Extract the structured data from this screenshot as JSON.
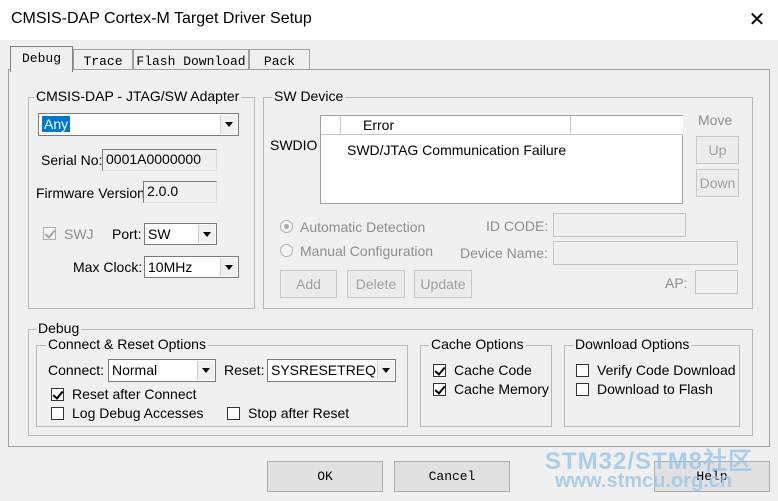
{
  "window": {
    "title": "CMSIS-DAP Cortex-M Target Driver Setup",
    "close_glyph": "✕"
  },
  "tabs": [
    {
      "label": "Debug",
      "active": true
    },
    {
      "label": "Trace",
      "active": false
    },
    {
      "label": "Flash Download",
      "active": false
    },
    {
      "label": "Pack",
      "active": false
    }
  ],
  "adapter": {
    "group_title": "CMSIS-DAP - JTAG/SW Adapter",
    "selected": "Any",
    "serial_label": "Serial No:",
    "serial_value": "0001A0000000",
    "firmware_label": "Firmware Version:",
    "firmware_value": "2.0.0",
    "swj_label": "SWJ",
    "swj_checked": true,
    "port_label": "Port:",
    "port_value": "SW",
    "maxclock_label": "Max Clock:",
    "maxclock_value": "10MHz"
  },
  "sw_device": {
    "group_title": "SW Device",
    "row_label": "SWDIO",
    "column_header": "Error",
    "error_text": "SWD/JTAG Communication Failure",
    "move_label": "Move",
    "up_label": "Up",
    "down_label": "Down",
    "auto_detect_label": "Automatic Detection",
    "manual_config_label": "Manual Configuration",
    "detection_mode": "Automatic Detection",
    "id_code_label": "ID CODE:",
    "device_name_label": "Device Name:",
    "ap_label": "AP:",
    "add_label": "Add",
    "delete_label": "Delete",
    "update_label": "Update"
  },
  "debug": {
    "group_title": "Debug",
    "connect_reset": {
      "title": "Connect & Reset Options",
      "connect_label": "Connect:",
      "connect_value": "Normal",
      "reset_label": "Reset:",
      "reset_value": "SYSRESETREQ",
      "reset_after_connect_label": "Reset after Connect",
      "reset_after_connect": true,
      "log_debug_label": "Log Debug Accesses",
      "log_debug": false,
      "stop_after_reset_label": "Stop after Reset",
      "stop_after_reset": false
    },
    "cache": {
      "title": "Cache Options",
      "cache_code_label": "Cache Code",
      "cache_code": true,
      "cache_memory_label": "Cache Memory",
      "cache_memory": true
    },
    "download": {
      "title": "Download Options",
      "verify_label": "Verify Code Download",
      "verify": false,
      "flash_label": "Download to Flash",
      "flash": false
    }
  },
  "buttons": {
    "ok": "OK",
    "cancel": "Cancel",
    "help": "Help"
  },
  "watermark": {
    "line1": "STM32/STM8社区",
    "line2": "www.stmcu.org.cn"
  }
}
